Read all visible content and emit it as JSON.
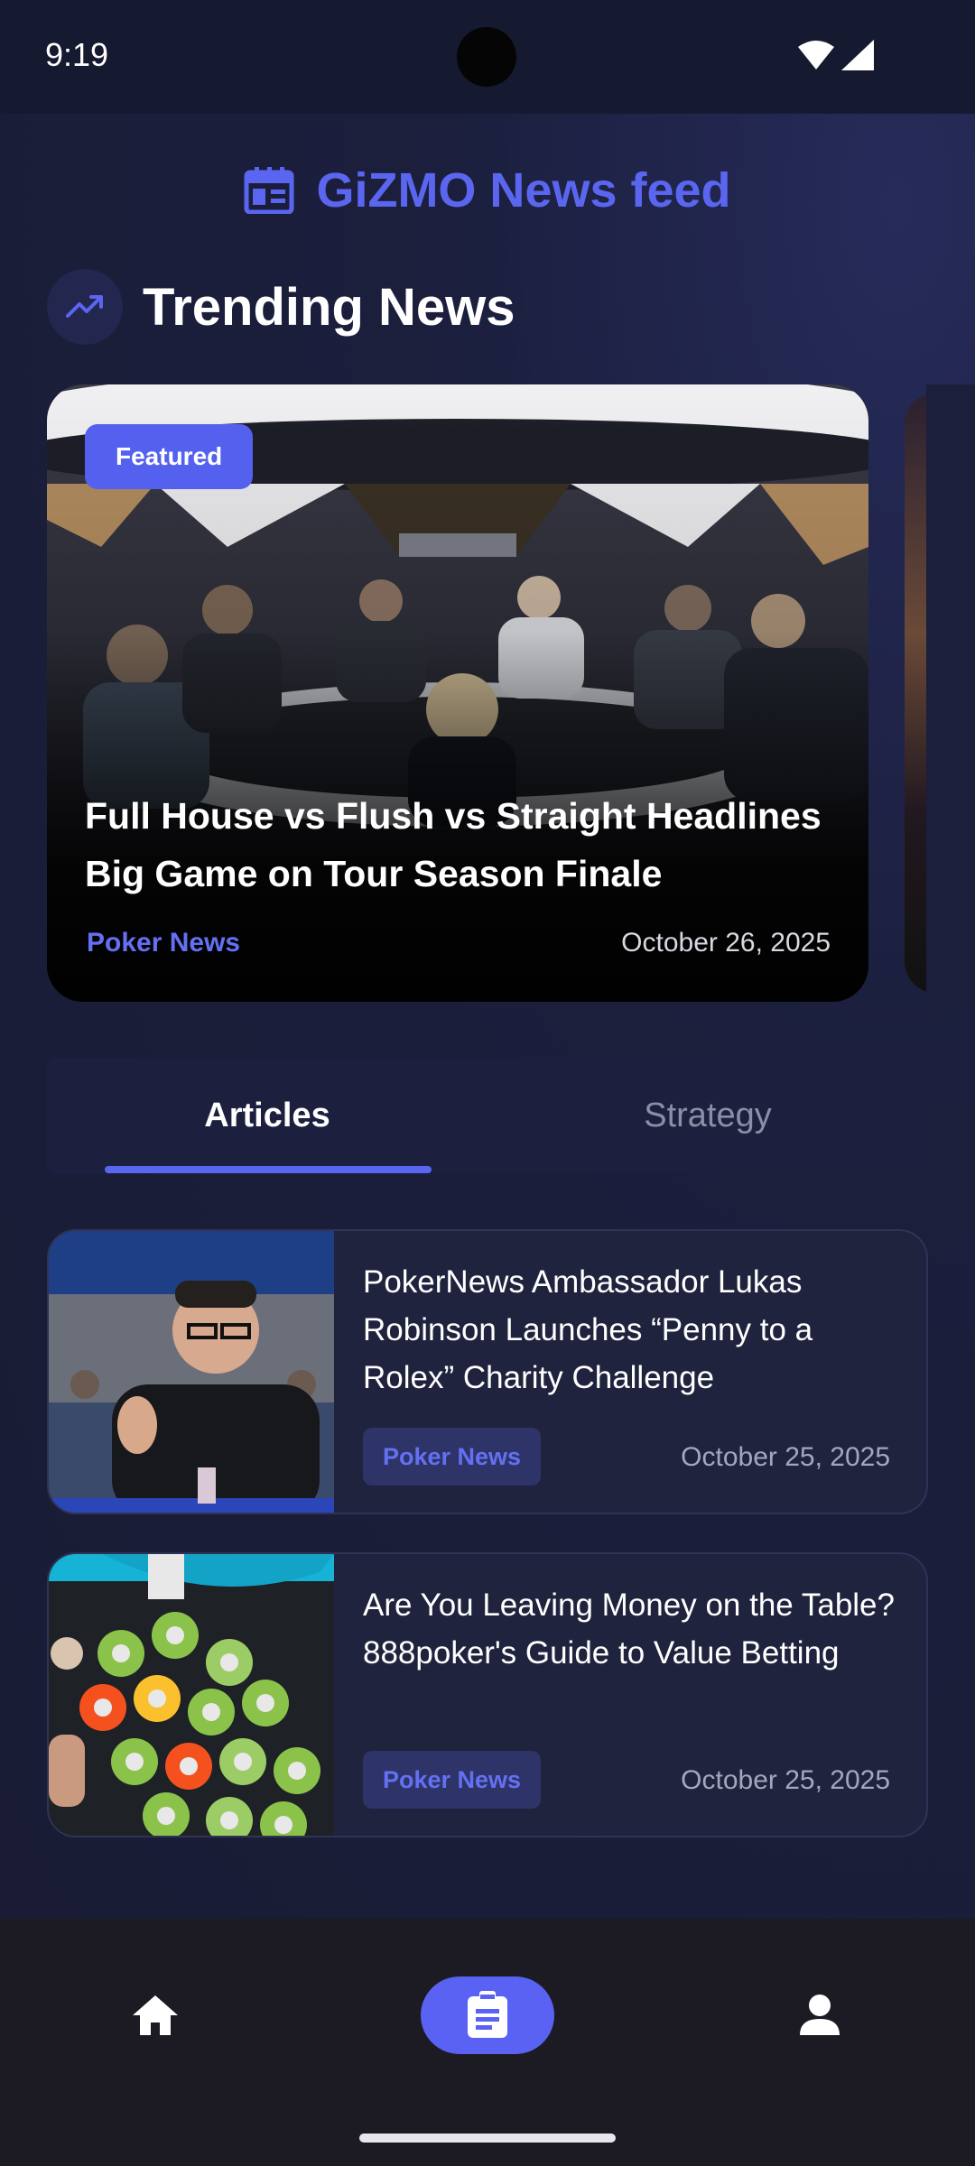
{
  "status_bar": {
    "time": "9:19"
  },
  "header": {
    "app_title": "GiZMO News feed",
    "icon": "newspaper-icon",
    "accent": "#5b66f0"
  },
  "trending": {
    "title": "Trending News",
    "icon": "trending-up-icon",
    "featured": {
      "badge": "Featured",
      "title": "Full House vs Flush vs Straight Headlines Big Game on Tour Season Finale",
      "category": "Poker News",
      "date": "October 26, 2025"
    }
  },
  "tabs": [
    {
      "label": "Articles",
      "selected": true
    },
    {
      "label": "Strategy",
      "selected": false
    }
  ],
  "articles": [
    {
      "title": "PokerNews Ambassador Lukas Robinson Launches “Penny to a Rolex” Charity Challenge",
      "category": "Poker News",
      "date": "October 25, 2025"
    },
    {
      "title": "Are You Leaving Money on the Table? 888poker's Guide to Value Betting",
      "category": "Poker News",
      "date": "October 25, 2025"
    }
  ],
  "bottom_nav": [
    {
      "icon": "home-icon",
      "selected": false
    },
    {
      "icon": "articles-icon",
      "selected": true
    },
    {
      "icon": "profile-icon",
      "selected": false
    }
  ]
}
